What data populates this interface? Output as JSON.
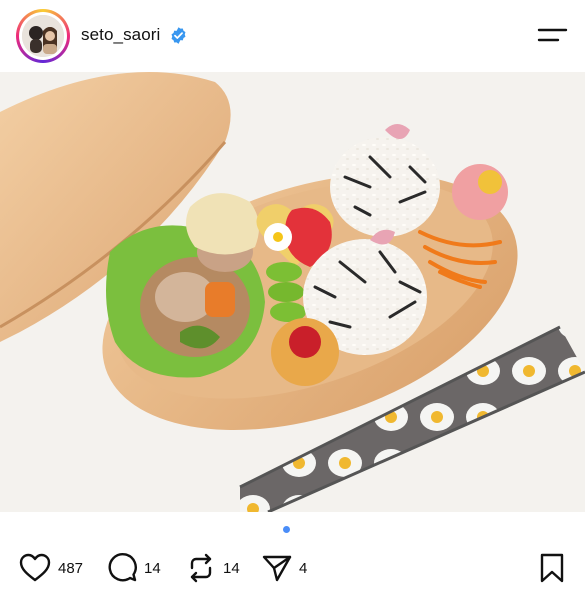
{
  "post": {
    "username": "seto_saori",
    "verified": true,
    "image_alt": "Bento box with rice balls, chicken stir-fry, strawberry, egg, carrots",
    "carousel": {
      "count": 1,
      "active": 0
    },
    "stats": {
      "likes": "487",
      "comments": "14",
      "reposts": "14",
      "shares": "4"
    }
  },
  "icons": {
    "verified": "verified-badge-icon",
    "menu": "menu-icon",
    "like": "heart-icon",
    "comment": "comment-bubble-icon",
    "repost": "repost-icon",
    "share": "send-icon",
    "save": "bookmark-icon"
  },
  "colors": {
    "verified_blue": "#3897f0",
    "dot_active": "#4a8df8"
  }
}
